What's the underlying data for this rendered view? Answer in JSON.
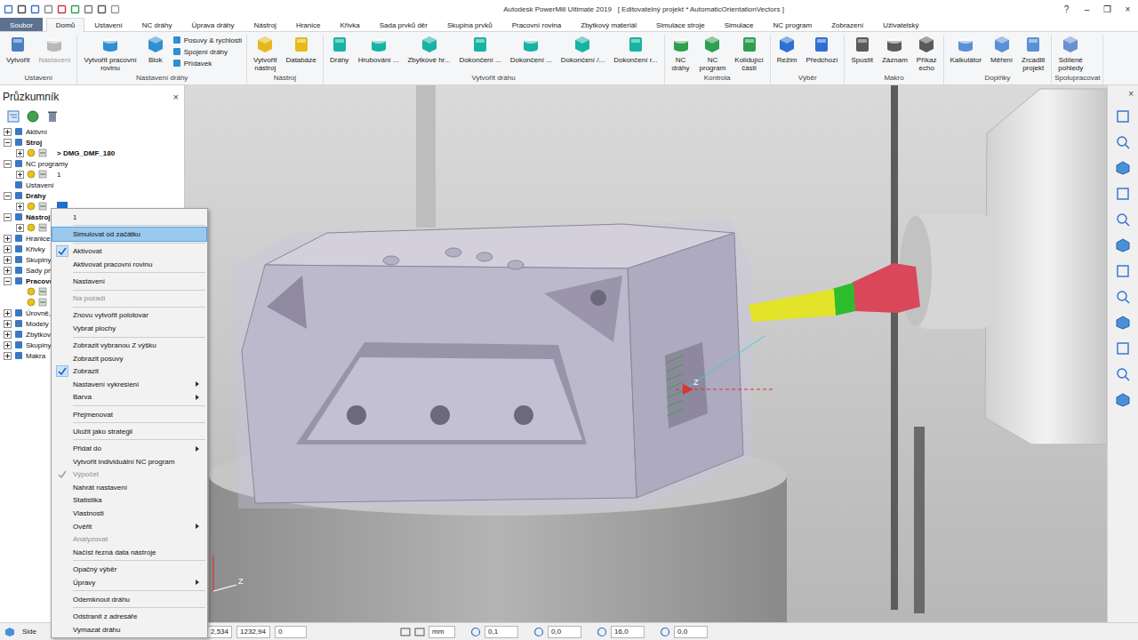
{
  "window": {
    "title": "Autodesk PowerMill Ultimate 2019   [ Editovatelný projekt * AutomaticOrientationVectors ]",
    "controls": [
      "?",
      "–",
      "❐",
      "×"
    ]
  },
  "ribbon_tabs": [
    {
      "label": "Soubor",
      "kind": "file",
      "selected": false
    },
    {
      "label": "Domů",
      "kind": "tab",
      "selected": true
    },
    {
      "label": "Ustavení",
      "kind": "tab",
      "selected": false
    },
    {
      "label": "NC dráhy",
      "kind": "tab",
      "selected": false
    },
    {
      "label": "Úprava dráhy",
      "kind": "tab",
      "selected": false
    },
    {
      "label": "Nástroj",
      "kind": "tab",
      "selected": false
    },
    {
      "label": "Hranice",
      "kind": "tab",
      "selected": false
    },
    {
      "label": "Křivka",
      "kind": "tab",
      "selected": false
    },
    {
      "label": "Sada prvků děr",
      "kind": "tab",
      "selected": false
    },
    {
      "label": "Skupina prvků",
      "kind": "tab",
      "selected": false
    },
    {
      "label": "Pracovní rovina",
      "kind": "tab",
      "selected": false
    },
    {
      "label": "Zbytkový materiál",
      "kind": "tab",
      "selected": false
    },
    {
      "label": "Simulace stroje",
      "kind": "tab",
      "selected": false
    },
    {
      "label": "Simulace",
      "kind": "tab",
      "selected": false
    },
    {
      "label": "NC program",
      "kind": "tab",
      "selected": false
    },
    {
      "label": "Zobrazení",
      "kind": "tab",
      "selected": false
    },
    {
      "label": "Uživatelský",
      "kind": "tab",
      "selected": false
    }
  ],
  "ribbon_groups": [
    {
      "label": "Ustavení",
      "buttons": [
        {
          "label": "Vytvořit",
          "kind": "large",
          "disabled": false
        },
        {
          "label": "Nastavení",
          "kind": "large",
          "disabled": true
        }
      ]
    },
    {
      "label": "Nastavení dráhy",
      "buttons": [
        {
          "label": "Vytvořit pracovní\nrovinu",
          "kind": "large",
          "disabled": false
        },
        {
          "label": "Blok",
          "kind": "large",
          "disabled": false
        },
        {
          "label": "Posuvy & rychlosti",
          "kind": "small",
          "disabled": false
        },
        {
          "label": "Spojení dráhy",
          "kind": "small",
          "disabled": false
        },
        {
          "label": "Přídavek",
          "kind": "small",
          "disabled": false
        }
      ]
    },
    {
      "label": "Nástroj",
      "buttons": [
        {
          "label": "Vytvořit\nnástroj",
          "kind": "large",
          "disabled": false
        },
        {
          "label": "Databáze",
          "kind": "large",
          "disabled": false
        }
      ]
    },
    {
      "label": "Vytvořit dráhu",
      "buttons": [
        {
          "label": "Dráhy",
          "kind": "large",
          "disabled": false
        },
        {
          "label": "Hrubování ...",
          "kind": "large",
          "disabled": false
        },
        {
          "label": "Zbytkové hr...",
          "kind": "large",
          "disabled": false
        },
        {
          "label": "Dokončení ...",
          "kind": "large",
          "disabled": false
        },
        {
          "label": "Dokončení ...",
          "kind": "large",
          "disabled": false
        },
        {
          "label": "Dokončení /...",
          "kind": "large",
          "disabled": false
        },
        {
          "label": "Dokončení r...",
          "kind": "large",
          "disabled": false
        }
      ]
    },
    {
      "label": "Kontrola",
      "buttons": [
        {
          "label": "NC\ndráhy",
          "kind": "large",
          "disabled": false
        },
        {
          "label": "NC\nprogram",
          "kind": "large",
          "disabled": false
        },
        {
          "label": "Kolidující\nčásti",
          "kind": "large",
          "disabled": false
        }
      ]
    },
    {
      "label": "Výběr",
      "buttons": [
        {
          "label": "Režim",
          "kind": "large",
          "disabled": false
        },
        {
          "label": "Předchozí",
          "kind": "large",
          "disabled": false
        }
      ]
    },
    {
      "label": "Makro",
      "buttons": [
        {
          "label": "Spustit",
          "kind": "large",
          "disabled": false
        },
        {
          "label": "Záznam",
          "kind": "large",
          "disabled": false
        },
        {
          "label": "Příkaz\necho",
          "kind": "large",
          "disabled": false
        }
      ]
    },
    {
      "label": "Doplňky",
      "buttons": [
        {
          "label": "Kalkulátor",
          "kind": "large",
          "disabled": false
        },
        {
          "label": "Měření",
          "kind": "large",
          "disabled": false
        },
        {
          "label": "Zrcadlit\nprojekt",
          "kind": "large",
          "disabled": false
        }
      ]
    },
    {
      "label": "Spolupracovat",
      "buttons": [
        {
          "label": "Sdílené\npohledy",
          "kind": "large",
          "disabled": false
        }
      ]
    }
  ],
  "explorer": {
    "title": "Průzkumník",
    "close": "×",
    "tree": [
      {
        "label": "Aktivní",
        "level": 0,
        "expandable": true,
        "expanded": false,
        "bold": false,
        "selected": false
      },
      {
        "label": "Stroj",
        "level": 0,
        "expandable": true,
        "expanded": true,
        "bold": true,
        "selected": false
      },
      {
        "label": "> DMG_DMF_180",
        "level": 1,
        "expandable": true,
        "expanded": false,
        "bold": true,
        "selected": false
      },
      {
        "label": "NC programy",
        "level": 0,
        "expandable": true,
        "expanded": true,
        "bold": false,
        "selected": false
      },
      {
        "label": "1",
        "level": 1,
        "expandable": true,
        "expanded": false,
        "bold": false,
        "selected": false
      },
      {
        "label": "Ustavení",
        "level": 0,
        "expandable": false,
        "expanded": false,
        "bold": false,
        "selected": false
      },
      {
        "label": "Dráhy",
        "level": 0,
        "expandable": true,
        "expanded": true,
        "bold": true,
        "selected": false
      },
      {
        "level": 1,
        "expandable": true,
        "expanded": false,
        "bold": false,
        "selected": true
      },
      {
        "label": "Nástroj",
        "level": 0,
        "expandable": true,
        "expanded": true,
        "bold": true,
        "selected": false
      },
      {
        "level": 1,
        "expandable": true,
        "expanded": false,
        "bold": false,
        "selected": false
      },
      {
        "label": "Hranice",
        "level": 0,
        "expandable": true,
        "expanded": false,
        "bold": false,
        "selected": false
      },
      {
        "label": "Křivky",
        "level": 0,
        "expandable": true,
        "expanded": false,
        "bold": false,
        "selected": false
      },
      {
        "label": "Skupiny",
        "level": 0,
        "expandable": true,
        "expanded": false,
        "bold": false,
        "selected": false
      },
      {
        "label": "Sady prv",
        "level": 0,
        "expandable": true,
        "expanded": false,
        "bold": false,
        "selected": false
      },
      {
        "label": "Pracovn",
        "level": 0,
        "expandable": true,
        "expanded": true,
        "bold": true,
        "selected": false
      },
      {
        "level": 1,
        "expandable": false,
        "expanded": false,
        "bold": false,
        "selected": false
      },
      {
        "level": 1,
        "expandable": false,
        "expanded": false,
        "bold": false,
        "selected": false
      },
      {
        "label": "Úrovně,",
        "level": 0,
        "expandable": true,
        "expanded": false,
        "bold": false,
        "selected": false
      },
      {
        "label": "Modely",
        "level": 0,
        "expandable": true,
        "expanded": false,
        "bold": false,
        "selected": false
      },
      {
        "label": "Zbytkov",
        "level": 0,
        "expandable": true,
        "expanded": false,
        "bold": false,
        "selected": false
      },
      {
        "label": "Skupiny",
        "level": 0,
        "expandable": true,
        "expanded": false,
        "bold": false,
        "selected": false
      },
      {
        "label": "Makra",
        "level": 0,
        "expandable": true,
        "expanded": false,
        "bold": false,
        "selected": false
      }
    ]
  },
  "context_menu": {
    "items": [
      {
        "kind": "header",
        "label": "1",
        "checked": false,
        "disabled": false,
        "selected": false,
        "submenu": false
      },
      {
        "kind": "separator"
      },
      {
        "kind": "item",
        "label": "Simulovat od začátku",
        "checked": false,
        "disabled": false,
        "selected": true,
        "submenu": false
      },
      {
        "kind": "separator"
      },
      {
        "kind": "item",
        "label": "Aktivovat",
        "checked": true,
        "disabled": false,
        "selected": false,
        "submenu": false
      },
      {
        "kind": "item",
        "label": "Aktivovat pracovní rovinu",
        "checked": false,
        "disabled": false,
        "selected": false,
        "submenu": false
      },
      {
        "kind": "separator"
      },
      {
        "kind": "item",
        "label": "Nastavení",
        "checked": false,
        "disabled": false,
        "selected": false,
        "submenu": false
      },
      {
        "kind": "separator"
      },
      {
        "kind": "item",
        "label": "Na pozadí",
        "checked": false,
        "disabled": true,
        "selected": false,
        "submenu": false
      },
      {
        "kind": "separator"
      },
      {
        "kind": "item",
        "label": "Znovu vytvořit polotovar",
        "checked": false,
        "disabled": false,
        "selected": false,
        "submenu": false
      },
      {
        "kind": "item",
        "label": "Vybrat plochy",
        "checked": false,
        "disabled": false,
        "selected": false,
        "submenu": false
      },
      {
        "kind": "separator"
      },
      {
        "kind": "item",
        "label": "Zobrazit vybranou Z výšku",
        "checked": false,
        "disabled": false,
        "selected": false,
        "submenu": false
      },
      {
        "kind": "item",
        "label": "Zobrazit posuvy",
        "checked": false,
        "disabled": false,
        "selected": false,
        "submenu": false
      },
      {
        "kind": "item",
        "label": "Zobrazit",
        "checked": true,
        "disabled": false,
        "selected": false,
        "submenu": false
      },
      {
        "kind": "item",
        "label": "Nastavení vykreslení",
        "checked": false,
        "disabled": false,
        "selected": false,
        "submenu": true
      },
      {
        "kind": "item",
        "label": "Barva",
        "checked": false,
        "disabled": false,
        "selected": false,
        "submenu": true
      },
      {
        "kind": "separator"
      },
      {
        "kind": "item",
        "label": "Přejmenovat",
        "checked": false,
        "disabled": false,
        "selected": false,
        "submenu": false
      },
      {
        "kind": "separator"
      },
      {
        "kind": "item",
        "label": "Uložit jako strategii",
        "checked": false,
        "disabled": false,
        "selected": false,
        "submenu": false
      },
      {
        "kind": "separator"
      },
      {
        "kind": "item",
        "label": "Přidat do",
        "checked": false,
        "disabled": false,
        "selected": false,
        "submenu": true
      },
      {
        "kind": "item",
        "label": "Vytvořit individuální NC program",
        "checked": false,
        "disabled": false,
        "selected": false,
        "submenu": false
      },
      {
        "kind": "item",
        "label": "Výpočet",
        "checked": true,
        "disabled": true,
        "selected": false,
        "submenu": false
      },
      {
        "kind": "item",
        "label": "Nahrát nastavení",
        "checked": false,
        "disabled": false,
        "selected": false,
        "submenu": false
      },
      {
        "kind": "item",
        "label": "Statistika",
        "checked": false,
        "disabled": false,
        "selected": false,
        "submenu": false
      },
      {
        "kind": "item",
        "label": "Vlastnosti",
        "checked": false,
        "disabled": false,
        "selected": false,
        "submenu": false
      },
      {
        "kind": "item",
        "label": "Ověřit",
        "checked": false,
        "disabled": false,
        "selected": false,
        "submenu": true
      },
      {
        "kind": "item",
        "label": "Analyzovat",
        "checked": false,
        "disabled": true,
        "selected": false,
        "submenu": false
      },
      {
        "kind": "item",
        "label": "Načíst řezná data nástroje",
        "checked": false,
        "disabled": false,
        "selected": false,
        "submenu": false
      },
      {
        "kind": "separator"
      },
      {
        "kind": "item",
        "label": "Opačný výběr",
        "checked": false,
        "disabled": false,
        "selected": false,
        "submenu": false
      },
      {
        "kind": "item",
        "label": "Úpravy",
        "checked": false,
        "disabled": false,
        "selected": false,
        "submenu": true
      },
      {
        "kind": "separator"
      },
      {
        "kind": "item",
        "label": "Odemknout dráhu",
        "checked": false,
        "disabled": false,
        "selected": false,
        "submenu": false
      },
      {
        "kind": "separator"
      },
      {
        "kind": "item",
        "label": "Odstranit z adresáře",
        "checked": false,
        "disabled": false,
        "selected": false,
        "submenu": false
      },
      {
        "kind": "item",
        "label": "Vymazat dráhu",
        "checked": false,
        "disabled": false,
        "selected": false,
        "submenu": false
      }
    ]
  },
  "viewport": {
    "axis_labels": [
      "Z",
      "Z"
    ]
  },
  "right_toolbar": {
    "close": "×"
  },
  "status_bar": {
    "view": "Side",
    "fields": [
      "2,534",
      "1232,94",
      "0"
    ],
    "units": "mm",
    "values": [
      "0,1",
      "0,0",
      "16,0",
      "0,0"
    ]
  }
}
